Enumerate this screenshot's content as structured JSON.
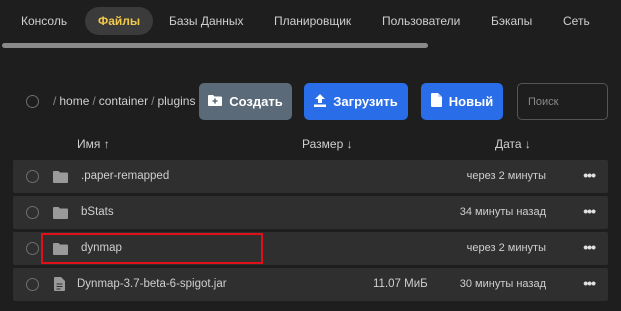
{
  "nav": {
    "tabs": [
      {
        "label": "Консоль"
      },
      {
        "label": "Файлы",
        "active": true
      },
      {
        "label": "Базы Данных"
      },
      {
        "label": "Планировщик"
      },
      {
        "label": "Пользователи"
      },
      {
        "label": "Бэкапы"
      },
      {
        "label": "Сеть"
      }
    ],
    "active_color": "#f2c94c"
  },
  "breadcrumb": {
    "separator": "/",
    "segments": [
      "home",
      "container",
      "plugins"
    ]
  },
  "toolbar": {
    "create_label": "Создать",
    "upload_label": "Загрузить",
    "new_label": "Новый",
    "search_placeholder": "Поиск",
    "primary_color": "#2a6de8",
    "secondary_color": "#5b6a79"
  },
  "table": {
    "columns": {
      "name": "Имя ↑",
      "size": "Размер ↓",
      "date": "Дата ↓"
    },
    "rows": [
      {
        "type": "folder",
        "name": ".paper-remapped",
        "size": "",
        "date": "через 2 минуты"
      },
      {
        "type": "folder",
        "name": "bStats",
        "size": "",
        "date": "34 минуты назад"
      },
      {
        "type": "folder",
        "name": "dynmap",
        "size": "",
        "date": "через 2 минуты",
        "highlighted": true
      },
      {
        "type": "file",
        "name": "Dynmap-3.7-beta-6-spigot.jar",
        "size": "11.07 МиБ",
        "date": "30 минуты назад"
      }
    ],
    "more_label": "•••"
  },
  "colors": {
    "background": "#1e1e1e",
    "row_background": "#2f2f2f",
    "highlight_border": "#e0101a"
  }
}
